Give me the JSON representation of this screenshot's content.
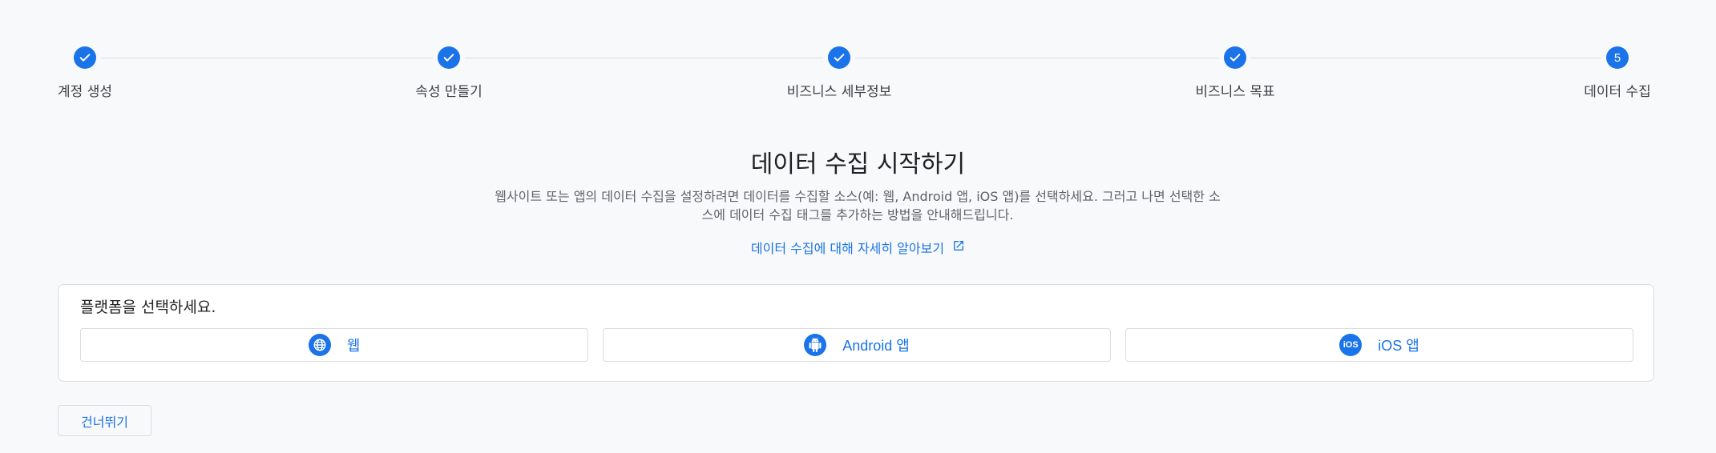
{
  "stepper": {
    "steps": [
      {
        "label": "계정 생성",
        "status": "done",
        "icon": "check-icon"
      },
      {
        "label": "속성 만들기",
        "status": "done",
        "icon": "check-icon"
      },
      {
        "label": "비즈니스 세부정보",
        "status": "done",
        "icon": "check-icon"
      },
      {
        "label": "비즈니스 목표",
        "status": "done",
        "icon": "check-icon"
      },
      {
        "label": "데이터 수집",
        "status": "current",
        "number": "5"
      }
    ]
  },
  "main": {
    "headline": "데이터 수집 시작하기",
    "description": "웹사이트 또는 앱의 데이터 수집을 설정하려면 데이터를 수집할 소스(예: 웹, Android 앱, iOS 앱)를 선택하세요. 그러고 나면 선택한 소스에 데이터 수집 태그를 추가하는 방법을 안내해드립니다.",
    "learn_more_link": "데이터 수집에 대해 자세히 알아보기",
    "learn_more_icon": "open-in-new-icon"
  },
  "platform_card": {
    "title": "플랫폼을 선택하세요.",
    "options": [
      {
        "label": "웹",
        "icon": "globe-icon"
      },
      {
        "label": "Android 앱",
        "icon": "android-icon"
      },
      {
        "label": "iOS 앱",
        "icon": "ios-icon",
        "icon_text": "iOS"
      }
    ]
  },
  "footer": {
    "skip_label": "건너뛰기"
  },
  "colors": {
    "accent": "#1a73e8",
    "background": "#f8f9fa",
    "border": "#dadce0"
  }
}
